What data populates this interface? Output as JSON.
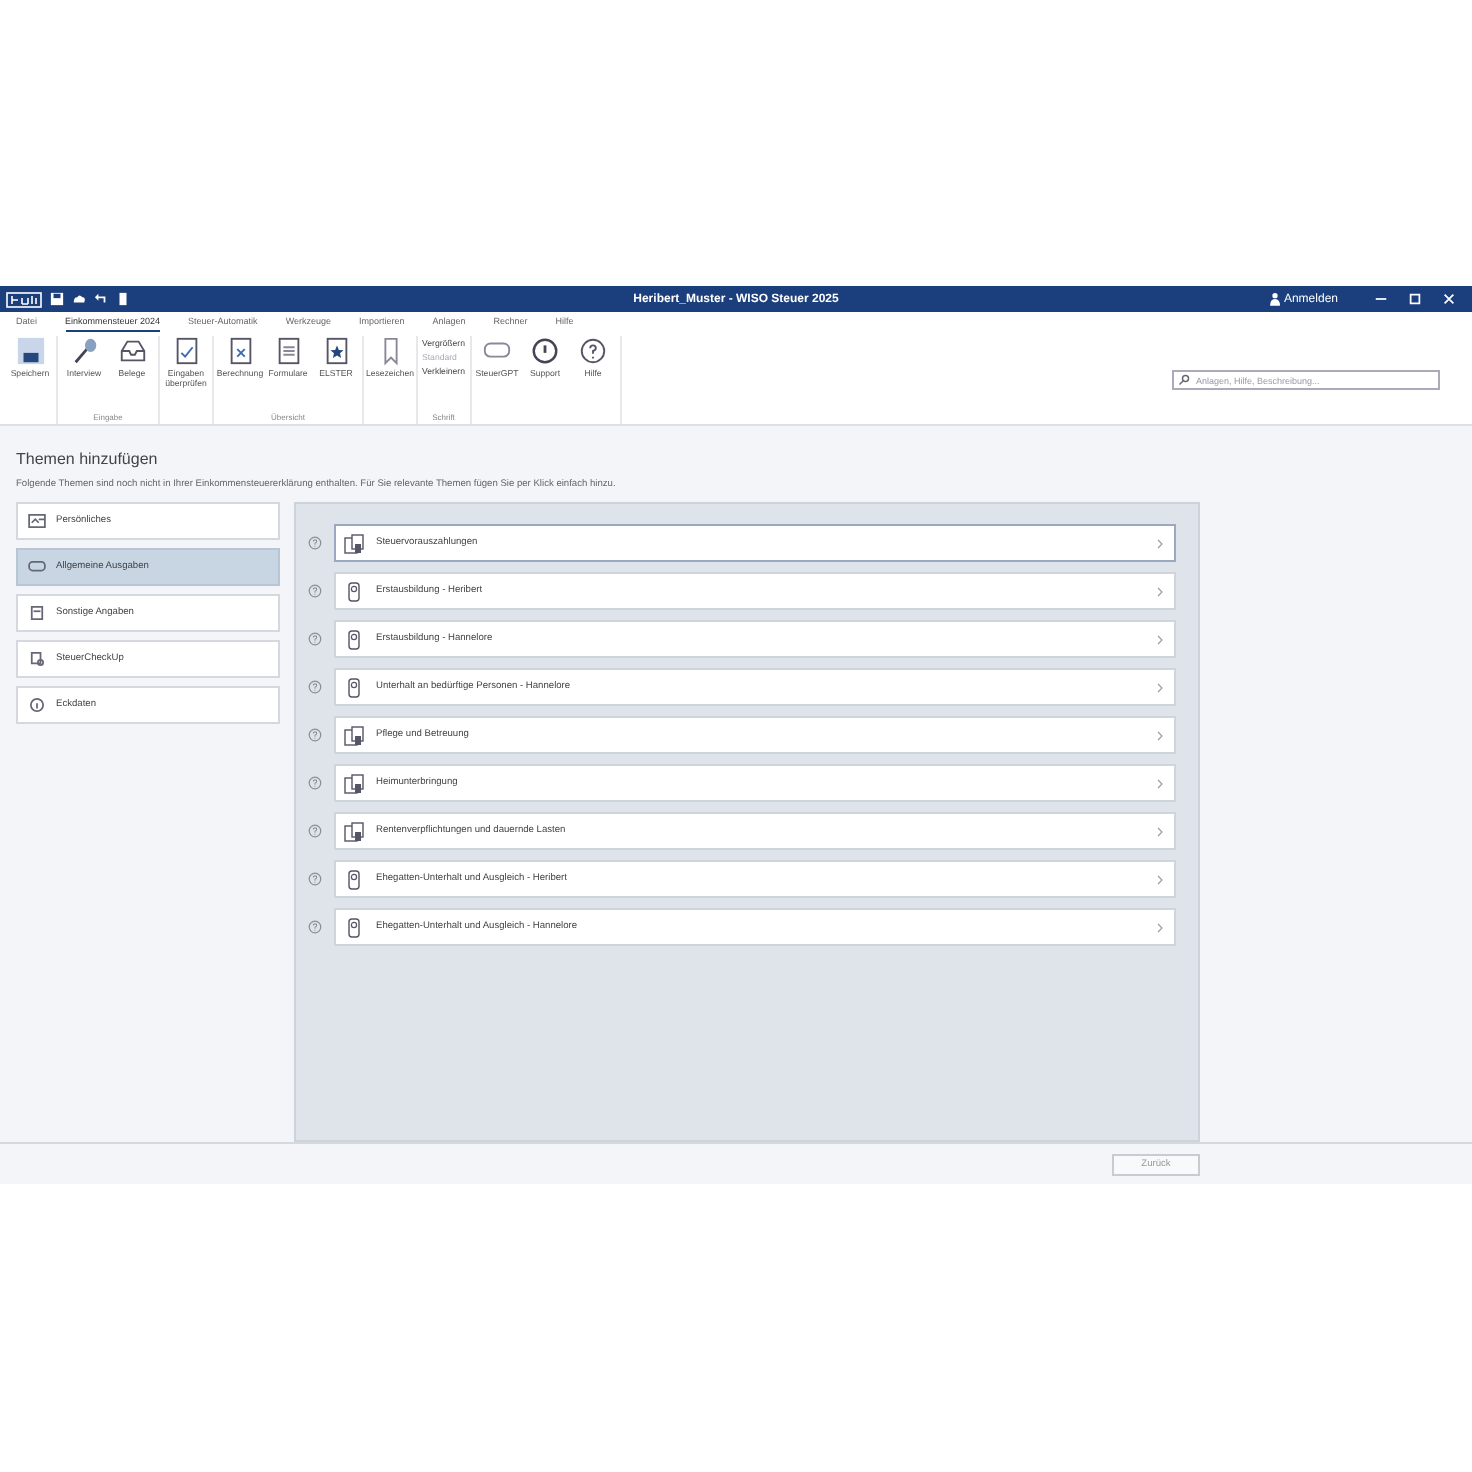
{
  "window": {
    "title": "Heribert_Muster - WISO Steuer 2025",
    "login": "Anmelden"
  },
  "menu_tabs": [
    {
      "label": "Datei",
      "selected": false
    },
    {
      "label": "Einkommensteuer 2024",
      "selected": true
    },
    {
      "label": "Steuer-Automatik",
      "selected": false
    },
    {
      "label": "Werkzeuge",
      "selected": false
    },
    {
      "label": "Importieren",
      "selected": false
    },
    {
      "label": "Anlagen",
      "selected": false
    },
    {
      "label": "Rechner",
      "selected": false
    },
    {
      "label": "Hilfe",
      "selected": false
    }
  ],
  "ribbon": [
    {
      "items": [
        {
          "kind": "large",
          "label": "Speichern"
        }
      ]
    },
    {
      "label": "Eingabe",
      "items": [
        {
          "kind": "large",
          "label": "Interview"
        },
        {
          "kind": "large",
          "label": "Belege"
        }
      ]
    },
    {
      "items": [
        {
          "kind": "large",
          "label": "Eingaben überprüfen"
        }
      ]
    },
    {
      "label": "Übersicht",
      "items": [
        {
          "kind": "large",
          "label": "Berechnung"
        },
        {
          "kind": "large",
          "label": "Formulare"
        },
        {
          "kind": "large",
          "label": "ELSTER"
        }
      ]
    },
    {
      "items": [
        {
          "kind": "large",
          "label": "Lesezeichen"
        }
      ]
    },
    {
      "label": "Schrift",
      "items": [
        {
          "kind": "small",
          "label": "Vergrößern",
          "disabled": false
        },
        {
          "kind": "small",
          "label": "Standard",
          "disabled": true
        },
        {
          "kind": "small",
          "label": "Verkleinern",
          "disabled": false
        }
      ]
    },
    {
      "items": [
        {
          "kind": "large",
          "label": "SteuerGPT"
        },
        {
          "kind": "large",
          "label": "Support"
        },
        {
          "kind": "large",
          "label": "Hilfe"
        }
      ]
    }
  ],
  "search": {
    "placeholder": "Anlagen, Hilfe, Beschreibung..."
  },
  "page": {
    "title": "Themen hinzufügen",
    "description": "Folgende Themen sind noch nicht in Ihrer Einkommensteuererklärung enthalten. Für Sie relevante Themen fügen Sie per Klick einfach hinzu."
  },
  "nav": [
    {
      "label": "Persönliches",
      "selected": false
    },
    {
      "label": "Allgemeine Ausgaben",
      "selected": true
    },
    {
      "label": "Sonstige Angaben",
      "selected": false
    },
    {
      "label": "SteuerCheckUp",
      "selected": false
    },
    {
      "label": "Eckdaten",
      "selected": false
    }
  ],
  "topics": [
    {
      "label": "Steuervorauszahlungen",
      "kind": "group",
      "selected": true
    },
    {
      "label": "Erstausbildung - Heribert",
      "kind": "person",
      "selected": false
    },
    {
      "label": "Erstausbildung - Hannelore",
      "kind": "person",
      "selected": false
    },
    {
      "label": "Unterhalt an bedürftige Personen - Hannelore",
      "kind": "person",
      "selected": false
    },
    {
      "label": "Pflege und Betreuung",
      "kind": "group",
      "selected": false
    },
    {
      "label": "Heimunterbringung",
      "kind": "group",
      "selected": false
    },
    {
      "label": "Rentenverpflichtungen und dauernde Lasten",
      "kind": "group",
      "selected": false
    },
    {
      "label": "Ehegatten-Unterhalt und Ausgleich - Heribert",
      "kind": "person",
      "selected": false
    },
    {
      "label": "Ehegatten-Unterhalt und Ausgleich - Hannelore",
      "kind": "person",
      "selected": false
    }
  ],
  "footer": {
    "back_button": {
      "label": "Zurück",
      "disabled": true
    }
  }
}
